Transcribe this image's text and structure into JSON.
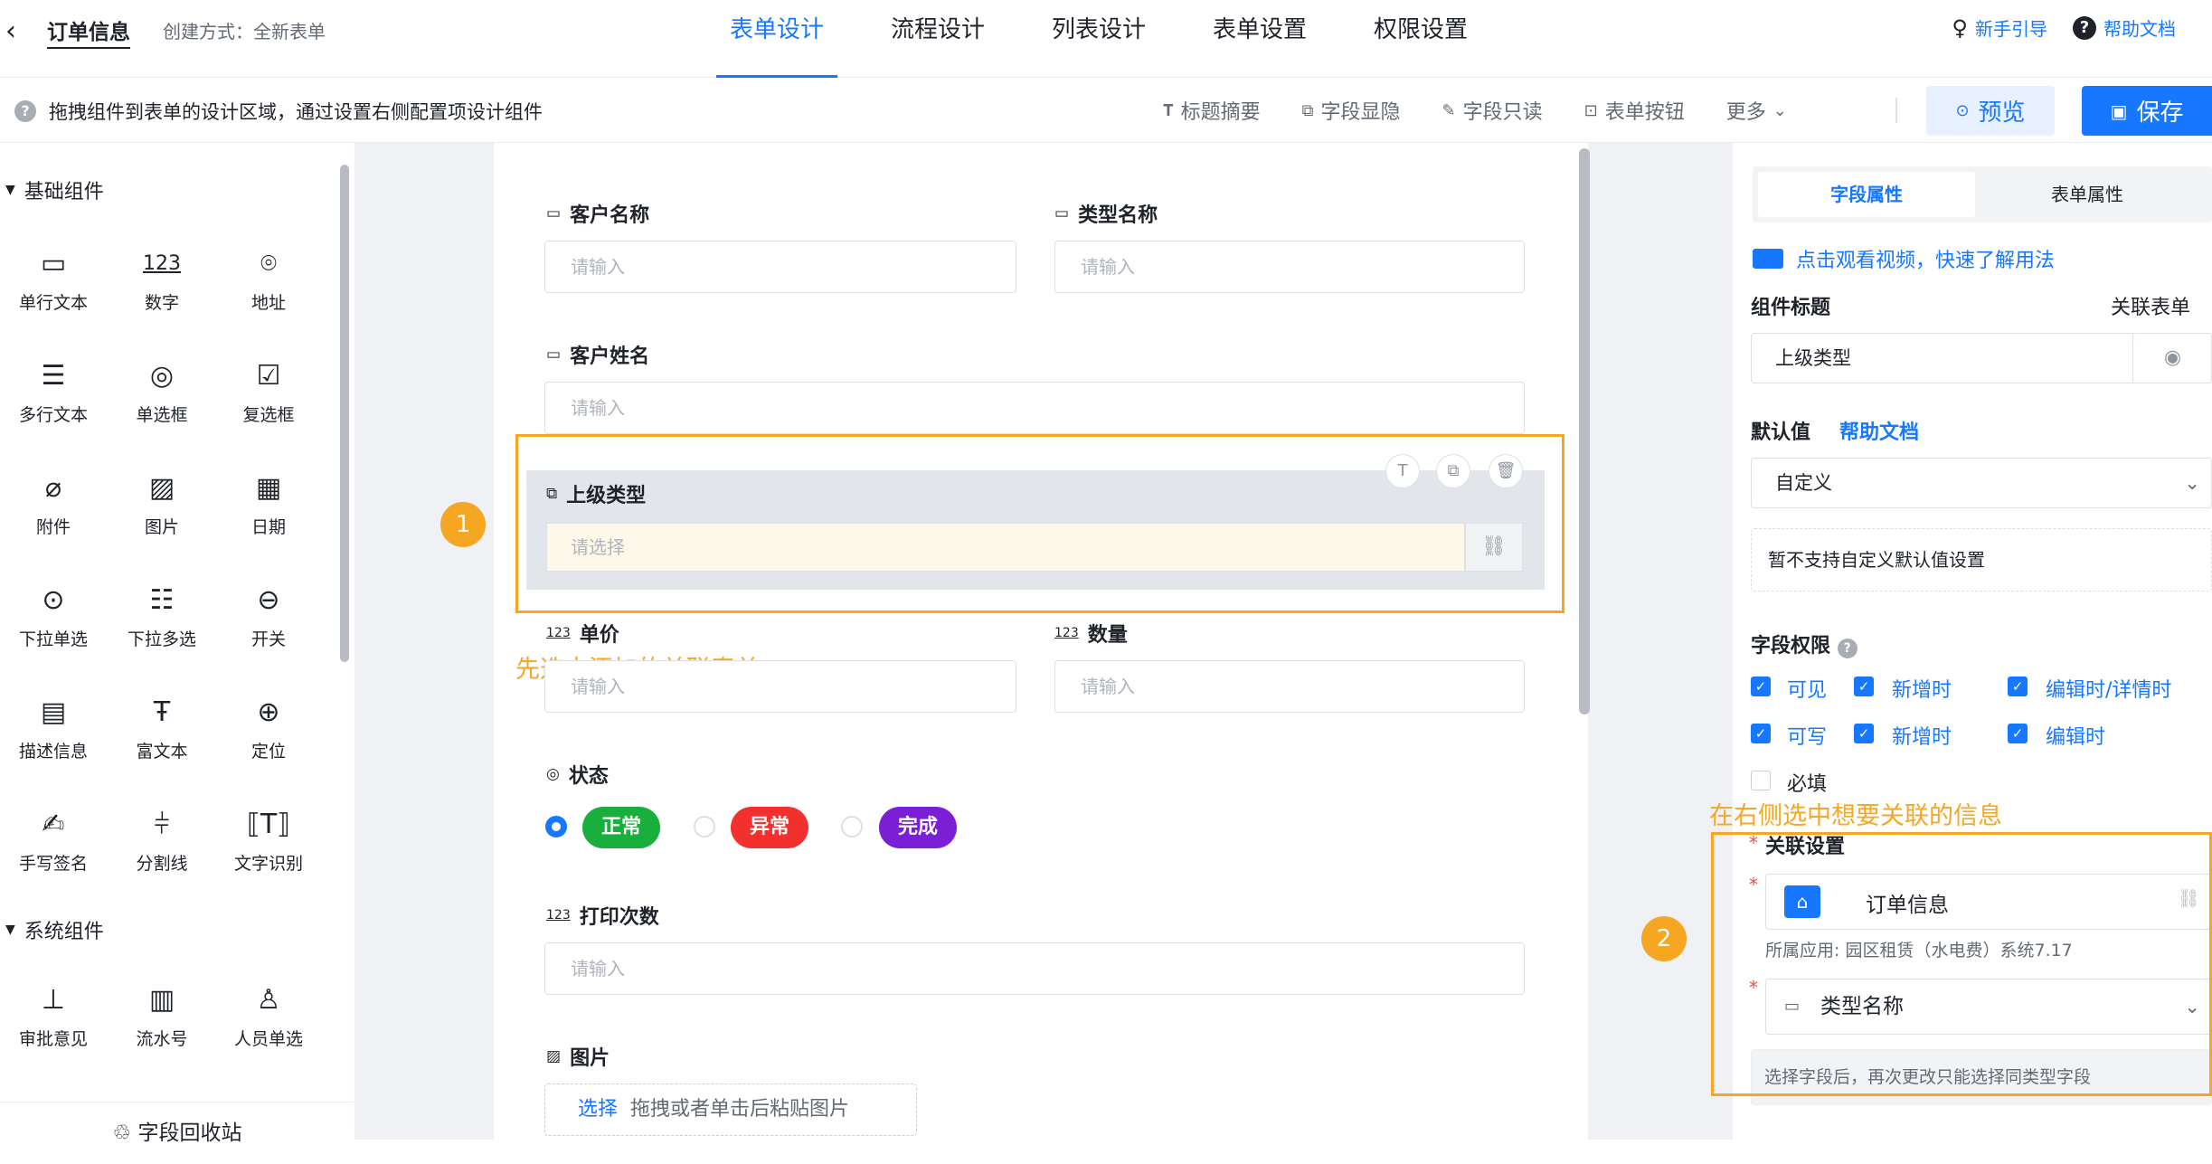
{
  "header": {
    "back_icon": "chevron-left-icon",
    "title": "订单信息",
    "create_label": "创建方式：",
    "create_value": "全新表单",
    "tabs": [
      {
        "label": "表单设计",
        "active": true
      },
      {
        "label": "流程设计"
      },
      {
        "label": "列表设计"
      },
      {
        "label": "表单设置"
      },
      {
        "label": "权限设置"
      }
    ],
    "guide": "新手引导",
    "help": "帮助文档"
  },
  "toolbar": {
    "hint": "拖拽组件到表单的设计区域，通过设置右侧配置项设计组件",
    "title_summary": "标题摘要",
    "field_visibility": "字段显隐",
    "field_readonly": "字段只读",
    "form_buttons": "表单按钮",
    "more": "更多",
    "preview": "预览",
    "save": "保存",
    "accent": "#1677ff"
  },
  "left": {
    "basic_title": "基础组件",
    "system_title": "系统组件",
    "recycle": "字段回收站",
    "basic": [
      "单行文本",
      "数字",
      "地址",
      "多行文本",
      "单选框",
      "复选框",
      "附件",
      "图片",
      "日期",
      "下拉单选",
      "下拉多选",
      "开关",
      "描述信息",
      "富文本",
      "定位",
      "手写签名",
      "分割线",
      "文字识别"
    ],
    "number_glyph": "123",
    "system": [
      "审批意见",
      "流水号",
      "人员单选"
    ]
  },
  "form": {
    "customer_name": "客户名称",
    "type_name": "类型名称",
    "customer_person": "客户姓名",
    "parent_type": "上级类型",
    "select_ph": "请选择",
    "input_ph": "请输入",
    "unit_price": "单价",
    "quantity": "数量",
    "status": "状态",
    "print_count": "打印次数",
    "image": "图片",
    "status_options": [
      {
        "label": "正常",
        "color": "#1aaf3c"
      },
      {
        "label": "异常",
        "color": "#f2302d"
      },
      {
        "label": "完成",
        "color": "#7a1fd6"
      }
    ],
    "upload_select": "选择",
    "upload_hint": "拖拽或者单击后粘贴图片",
    "num_glyph": "123"
  },
  "annotations": {
    "badge1": "1",
    "badge2": "2",
    "note1": "先选中添加的关联表单",
    "note2": "在右侧选中想要关联的信息",
    "color": "#f5a623"
  },
  "right": {
    "tab_field": "字段属性",
    "tab_form": "表单属性",
    "video": "点击观看视频，快速了解用法",
    "component_title": "组件标题",
    "related_form": "关联表单",
    "title_value": "上级类型",
    "default_label": "默认值",
    "help_doc": "帮助文档",
    "default_value": "自定义",
    "default_note": "暂不支持自定义默认值设置",
    "perm_label": "字段权限",
    "visible": "可见",
    "writable": "可写",
    "add_time": "新增时",
    "edit_detail": "编辑时/详情时",
    "edit_time": "编辑时",
    "required": "必填",
    "rel_label": "关联设置",
    "rel_form": "订单信息",
    "rel_app": "所属应用: 园区租赁（水电费）系统7.17",
    "rel_field": "类型名称",
    "rel_note": "选择字段后，再次更改只能选择同类型字段"
  }
}
